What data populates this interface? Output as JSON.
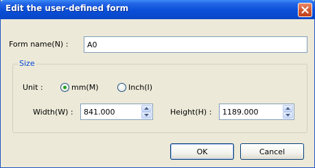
{
  "dialog": {
    "title": "Edit the user-defined form",
    "close_icon": "close-icon",
    "accent": "#0a4fd8"
  },
  "form_name": {
    "label": "Form name(N) :",
    "value": "A0"
  },
  "size": {
    "caption": "Size",
    "caption_color": "#0046d5",
    "unit_label": "Unit :",
    "unit_options": [
      "mm(M)",
      "Inch(I)"
    ],
    "unit_selected": "mm(M)",
    "width_label": "Width(W) :",
    "width_value": "841.000",
    "height_label": "Height(H) :",
    "height_value": "1189.000"
  },
  "buttons": {
    "ok": "OK",
    "cancel": "Cancel"
  }
}
